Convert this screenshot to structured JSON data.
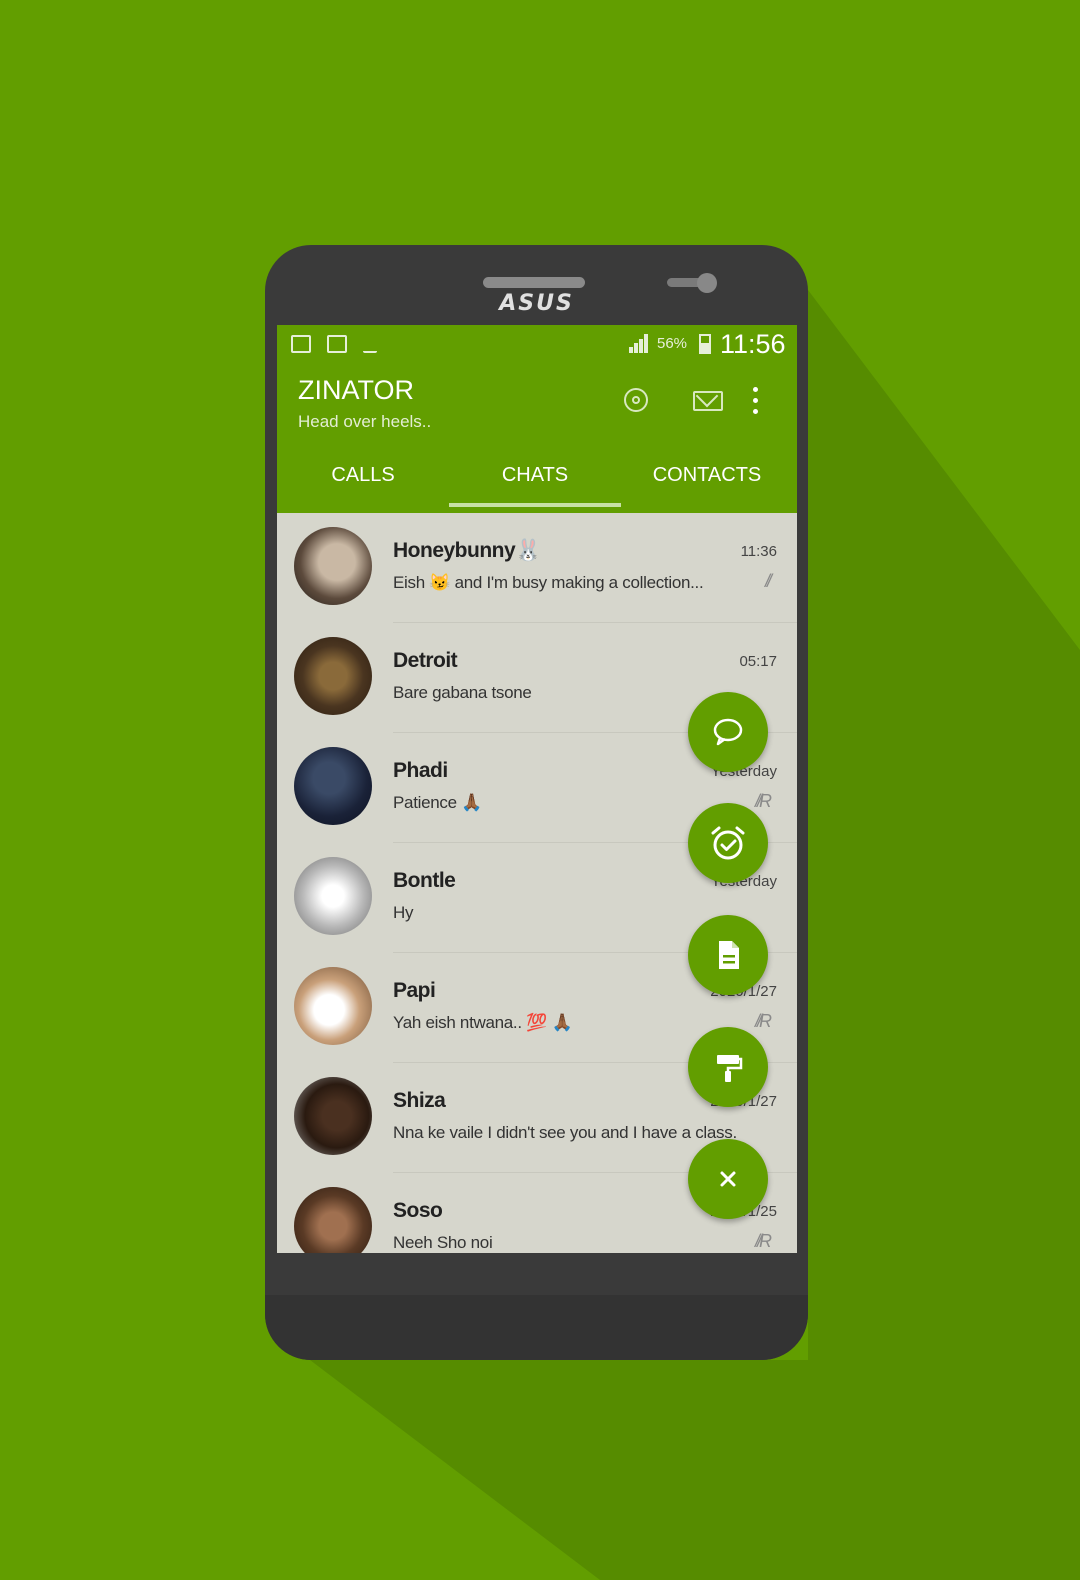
{
  "device": {
    "brand": "ASUS"
  },
  "status_bar": {
    "battery_percent": "56%",
    "clock": "11:56"
  },
  "header": {
    "title": "ZINATOR",
    "subtitle": "Head over heels.."
  },
  "tabs": [
    {
      "label": "CALLS",
      "selected": false
    },
    {
      "label": "CHATS",
      "selected": true
    },
    {
      "label": "CONTACTS",
      "selected": false
    }
  ],
  "chats": [
    {
      "name": "Honeybunny🐰",
      "preview": "Eish 😼 and I'm busy making a collection...",
      "time": "11:36",
      "tick": "//"
    },
    {
      "name": "Detroit",
      "preview": "Bare gabana tsone",
      "time": "05:17",
      "tick": ""
    },
    {
      "name": "Phadi",
      "preview": "Patience 🙏🏾",
      "time": "Yesterday",
      "tick": "//R"
    },
    {
      "name": "Bontle",
      "preview": "Hy",
      "time": "Yesterday",
      "tick": ""
    },
    {
      "name": "Papi",
      "preview": "Yah eish ntwana.. 💯 🙏🏾",
      "time": "2020/1/27",
      "tick": "//R"
    },
    {
      "name": "Shiza",
      "preview": "Nna ke vaile I didn't see you and I have a class.",
      "time": "2020/1/27",
      "tick": ""
    },
    {
      "name": "Soso",
      "preview": "Neeh Sho noi",
      "time": "2020/1/25",
      "tick": "//R"
    }
  ],
  "fab_menu": [
    {
      "icon": "chat-bubble-icon"
    },
    {
      "icon": "alarm-check-icon"
    },
    {
      "icon": "document-icon"
    },
    {
      "icon": "paint-roller-icon"
    },
    {
      "icon": "close-icon"
    }
  ],
  "colors": {
    "accent": "#629e00",
    "list_bg": "#d6d6cc",
    "phone_body": "#3a3a3a"
  }
}
